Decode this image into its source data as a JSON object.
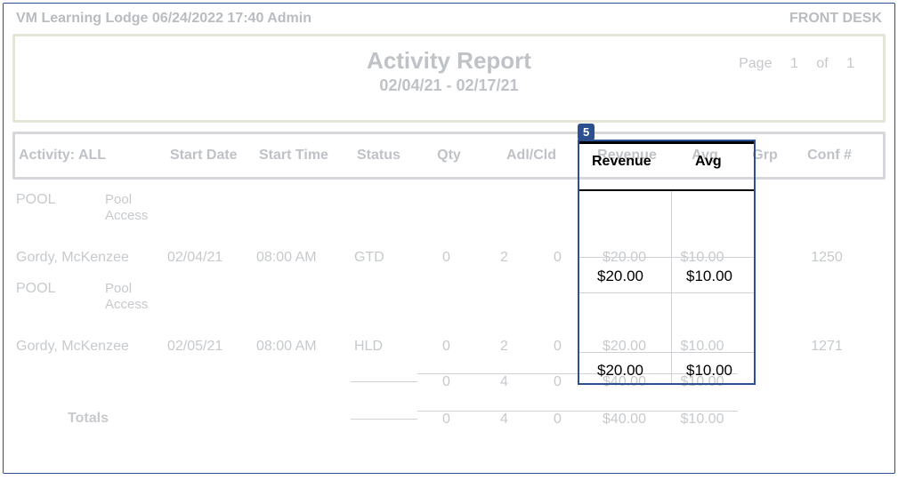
{
  "header": {
    "left": "VM Learning Lodge 06/24/2022 17:40  Admin",
    "right": "FRONT DESK"
  },
  "title": {
    "main": "Activity Report",
    "range": "02/04/21 - 02/17/21"
  },
  "page": {
    "label": "Page",
    "current": "1",
    "of_label": "of",
    "total": "1"
  },
  "columns": {
    "activity": "Activity: ALL",
    "start_date": "Start Date",
    "start_time": "Start Time",
    "status": "Status",
    "qty": "Qty",
    "adl_cld": "Adl/Cld",
    "revenue": "Revenue",
    "avg": "Avg",
    "grp": "Grp",
    "conf": "Conf #"
  },
  "sections": [
    {
      "code": "POOL",
      "desc": "Pool Access",
      "rows": [
        {
          "guest": "Gordy, McKenzee",
          "date": "02/04/21",
          "time": "08:00 AM",
          "status": "GTD",
          "qty": "0",
          "adl": "2",
          "cld": "0",
          "revenue": "$20.00",
          "avg": "$10.00",
          "grp": "",
          "conf": "1250"
        }
      ]
    },
    {
      "code": "POOL",
      "desc": "Pool Access",
      "rows": [
        {
          "guest": "Gordy, McKenzee",
          "date": "02/05/21",
          "time": "08:00 AM",
          "status": "HLD",
          "qty": "0",
          "adl": "2",
          "cld": "0",
          "revenue": "$20.00",
          "avg": "$10.00",
          "grp": "",
          "conf": "1271"
        }
      ]
    }
  ],
  "subtotals": {
    "qty": "0",
    "adl": "4",
    "cld": "0",
    "revenue": "$40.00",
    "avg": "$10.00"
  },
  "totals": {
    "label": "Totals",
    "qty": "0",
    "adl": "4",
    "cld": "0",
    "revenue": "$40.00",
    "avg": "$10.00"
  },
  "highlight": {
    "badge": "5"
  }
}
